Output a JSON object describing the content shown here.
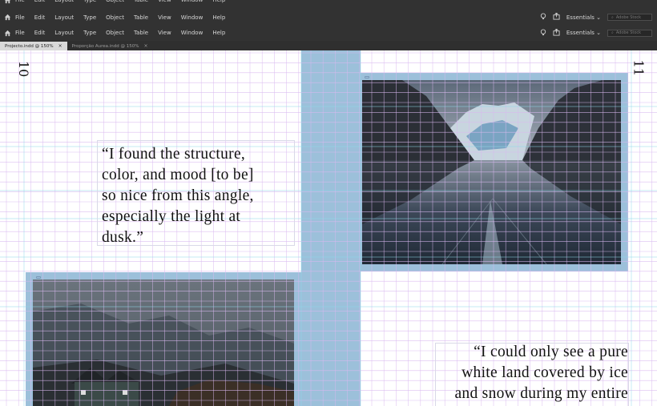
{
  "menubar": {
    "items": [
      "File",
      "Edit",
      "Layout",
      "Type",
      "Object",
      "Table",
      "View",
      "Window",
      "Help"
    ],
    "workspace": "Essentials",
    "search_placeholder": "Adobe Stock"
  },
  "tabs": [
    {
      "label": "Projecto.indd @ 150%",
      "close": "×"
    },
    {
      "label": "Proporção Aurea.indd @ 150%",
      "close": "×"
    }
  ],
  "document": {
    "page_left_number": "10",
    "page_right_number": "11",
    "quote_left": [
      "“I found the structure,",
      "color, and mood [to be]",
      "so nice from this angle,",
      "especially the light at",
      "dusk.”"
    ],
    "quote_right": [
      "“I could only see a pure",
      "white land covered by ice",
      "and snow during my entire"
    ]
  },
  "colors": {
    "frame_blue": "#9cc0da",
    "grid_magenta": "#d9b8f0",
    "grid_cyan": "#8fd8e8"
  }
}
